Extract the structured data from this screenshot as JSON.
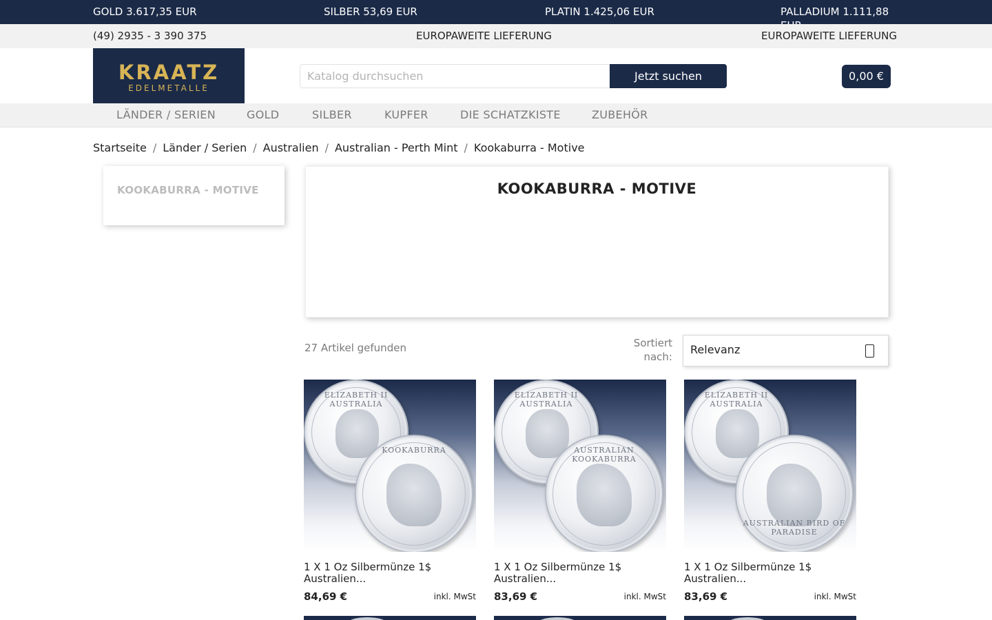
{
  "ticker": [
    {
      "label": "GOLD 3.617,35 EUR"
    },
    {
      "label": "SILBER 53,69 EUR"
    },
    {
      "label": "PLATIN 1.425,06 EUR"
    },
    {
      "label": "PALLADIUM 1.111,88 EUR"
    }
  ],
  "contact": {
    "phone": "(49) 2935 - 3 390 375",
    "shipping_1": "EUROPAWEITE LIEFERUNG",
    "shipping_2": "EUROPAWEITE LIEFERUNG"
  },
  "logo": {
    "word": "KRAATZ",
    "sub": "EDELMETALLE"
  },
  "search": {
    "placeholder": "Katalog durchsuchen",
    "button": "Jetzt suchen"
  },
  "cart": {
    "total": "0,00 €"
  },
  "nav": [
    "LÄNDER / SERIEN",
    "GOLD",
    "SILBER",
    "KUPFER",
    "DIE SCHATZKISTE",
    "ZUBEHÖR"
  ],
  "breadcrumb": [
    "Startseite",
    "Länder / Serien",
    "Australien",
    "Australian - Perth Mint",
    "Kookaburra - Motive"
  ],
  "sidebar": {
    "title": "KOOKABURRA - MOTIVE"
  },
  "category": {
    "title": "KOOKABURRA - MOTIVE"
  },
  "results": {
    "count": "27 Artikel gefunden",
    "sort_label": "Sortiert nach:",
    "sort_value": "Relevanz"
  },
  "products": [
    {
      "name": "1 X 1 Oz Silbermünze 1$ Australien...",
      "price": "84,69 €",
      "tax": "inkl. MwSt",
      "obverse_legend": "ELIZABETH II AUSTRALIA",
      "reverse_legend": "KOOKABURRA"
    },
    {
      "name": "1 X 1 Oz Silbermünze 1$ Australien...",
      "price": "83,69 €",
      "tax": "inkl. MwSt",
      "obverse_legend": "ELIZABETH II AUSTRALIA",
      "reverse_legend": "AUSTRALIAN KOOKABURRA"
    },
    {
      "name": "1 X 1 Oz Silbermünze 1$ Australien...",
      "price": "83,69 €",
      "tax": "inkl. MwSt",
      "obverse_legend": "ELIZABETH II AUSTRALIA",
      "reverse_legend": "AUSTRALIAN BIRD OF PARADISE"
    }
  ],
  "colors": {
    "navy": "#1b2a47",
    "gold": "#d8b456",
    "nav_bg": "#f1f1f1"
  }
}
